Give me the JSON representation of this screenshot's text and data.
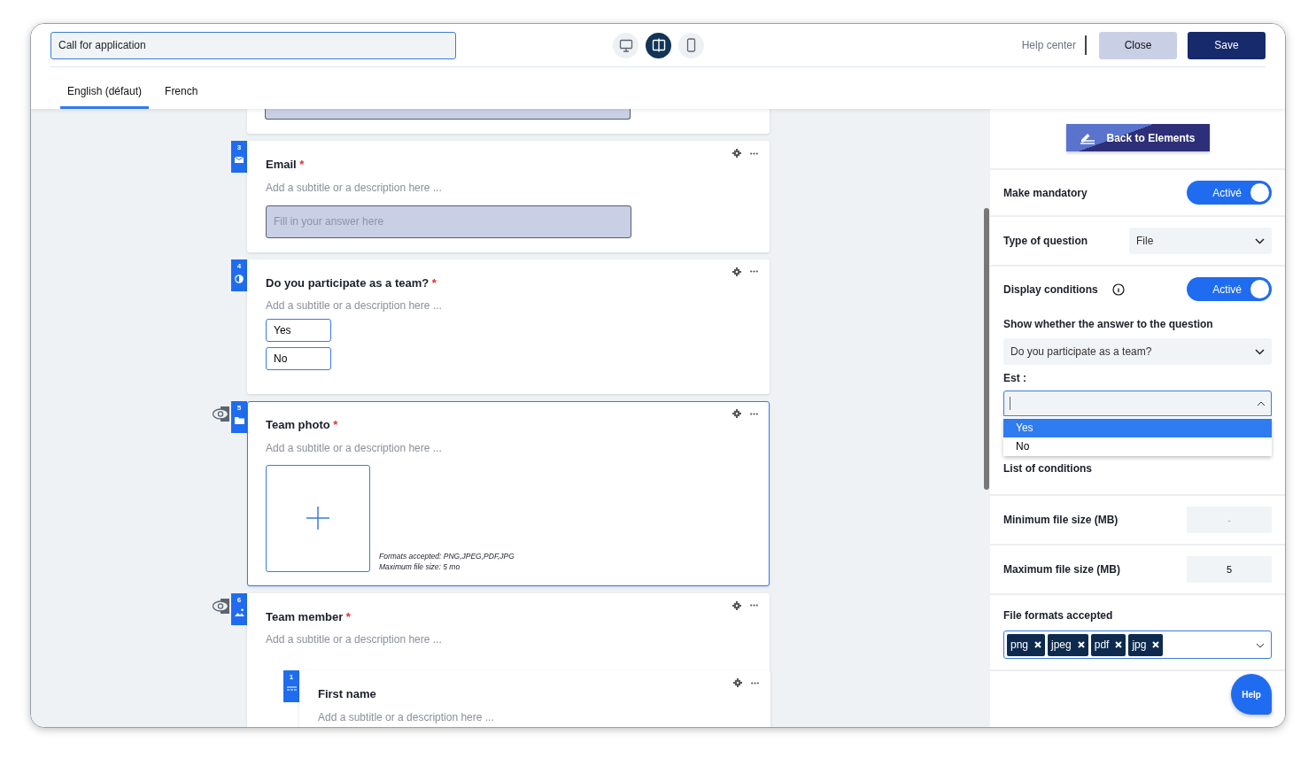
{
  "header": {
    "title_value": "Call for application",
    "view_modes": [
      {
        "kind": "desktop",
        "selected": false
      },
      {
        "kind": "split",
        "selected": true
      },
      {
        "kind": "mobile",
        "selected": false
      }
    ],
    "help_link": "Help center",
    "buttons": [
      {
        "label": "Close",
        "kind": "secondary"
      },
      {
        "label": "Save",
        "kind": "primary"
      }
    ]
  },
  "language_tabs": [
    {
      "label": "English (défaut)",
      "selected": true
    },
    {
      "label": "French",
      "selected": false
    }
  ],
  "questions": [
    {
      "kind": "cut_off"
    },
    {
      "kind": "text",
      "number": "3",
      "title": "Email",
      "required_mark": "*",
      "subtitle_placeholder": "Add a subtitle or a description here ...",
      "answer_placeholder": "Fill in your answer here",
      "selected": false,
      "conditional": false
    },
    {
      "kind": "choices",
      "number": "4",
      "title": "Do you participate as a team?",
      "required_mark": "*",
      "subtitle_placeholder": "Add a subtitle or a description here ...",
      "options": [
        "Yes",
        "No"
      ],
      "selected": false,
      "conditional": false
    },
    {
      "kind": "file",
      "number": "5",
      "title": "Team photo",
      "required_mark": "*",
      "subtitle_placeholder": "Add a subtitle or a description here ...",
      "formats_note": "Formats accepted: PNG,JPEG,PDF,JPG",
      "size_note": "Maximum file size: 5 mo",
      "selected": true,
      "conditional": true
    },
    {
      "kind": "group",
      "number": "6",
      "title": "Team member",
      "required_mark": "*",
      "subtitle_placeholder": "Add a subtitle or a description here ...",
      "selected": false,
      "conditional": true,
      "children": [
        {
          "kind": "short",
          "number": "1",
          "title": "First name",
          "subtitle_placeholder": "Add a subtitle or a description here ...",
          "selected": false,
          "conditional": false
        }
      ]
    }
  ],
  "settings": {
    "back_button": "Back to Elements",
    "mandatory": {
      "label": "Make mandatory",
      "on": true,
      "state_text": "Activé"
    },
    "question_type": {
      "label": "Type of question",
      "value": "File"
    },
    "display_conditions": {
      "label": "Display conditions",
      "on": true,
      "state_text": "Activé",
      "question_label": "Show whether the answer to the question",
      "question_value": "Do you participate as a team?",
      "is_label": "Est :",
      "is_options": [
        {
          "label": "Yes",
          "selected": true
        },
        {
          "label": "No",
          "selected": false
        }
      ],
      "list_label": "List of conditions"
    },
    "min_size": {
      "label": "Minimum file size (MB)",
      "placeholder": "-"
    },
    "max_size": {
      "label": "Maximum file size (MB)",
      "value": "5"
    },
    "formats": {
      "label": "File formats accepted",
      "tags": [
        "png",
        "jpeg",
        "pdf",
        "jpg"
      ]
    },
    "help_button": "Help"
  }
}
